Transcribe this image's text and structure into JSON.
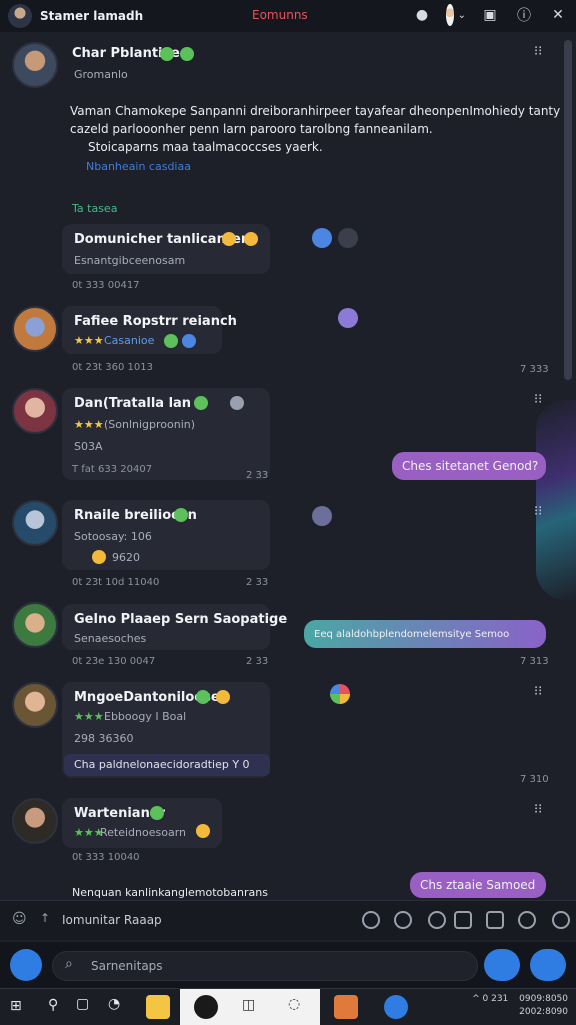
{
  "window": {
    "app_title": "Stamer lamadh",
    "center_title": "Eomunns"
  },
  "feed": {
    "post1": {
      "name": "Char Pblantive",
      "sub": "Gromanlo",
      "body_line1": "Vaman Chamokepe Sanpanni dreiboranhirpeer tayafear dheonpenImohiedy tanty",
      "body_line2": "cazeld parlooonher penn larn parooro tarolbng fanneanilam.",
      "body_line3": "Stoicaparns maa taalmacoccses yaerk.",
      "link": "Nbanheain casdiaa"
    },
    "section_label": "Ta tasea",
    "msg1": {
      "name": "Domunicher tanlicanter",
      "sub": "Esnantgibceenosam",
      "meta": "0t 333  00417"
    },
    "msg2": {
      "name": "Fafiee Ropstrr reianch",
      "sub": "Casanioe",
      "meta": "0t 23t  360 1013",
      "meta_r": "7 333"
    },
    "msg3": {
      "name": "Dan(Tratalla  lan",
      "sub": "(Sonlnigproonin)",
      "sub2": "S03A",
      "meta": "T fat  633  20407",
      "meta_r": "2 33",
      "out": "Ches sitetanet Genod?"
    },
    "msg4": {
      "name": "Rnaile breilioesn",
      "sub": "Sotoosay: 106",
      "sub2": "9620",
      "meta": "0t 23t  10d  11040",
      "meta_r": "2 33"
    },
    "msg5": {
      "name": "Gelno Plaaep Sern Saopatige",
      "sub": "Senaesoches",
      "meta": "0t 23e  130  0047",
      "meta_r": "2 33",
      "out": "Eeq alaldohbplendomelemsitye Semoo",
      "out_time": "7 313"
    },
    "msg6": {
      "name": "MngoeDantoniloesen",
      "sub": "Ebboogy I Boal",
      "sub2": "298 36360",
      "reply": "Cha paldnelonaecidoradtiep Y 0",
      "meta_r": "7 310"
    },
    "msg7": {
      "name": "Wartenianer",
      "sub": "Reteidnoesoarn",
      "meta": "0t 333  10040",
      "out": "Chs ztaaie Samoed",
      "body_bottom": "Nenquan kanlinkanglemotobanrans"
    }
  },
  "composer": {
    "placeholder": "Iomunitar Raaap"
  },
  "search": {
    "placeholder": "Sarnenitaps"
  },
  "clock": {
    "time": "^ 0  231",
    "date": "0909:8050",
    "date2": "2002:8090"
  },
  "colors": {
    "accent": "#2f7de3",
    "brand_red": "#e5535f",
    "outgoing_purple": "#9a5fc2",
    "outgoing_teal": "#4aa7a4"
  }
}
